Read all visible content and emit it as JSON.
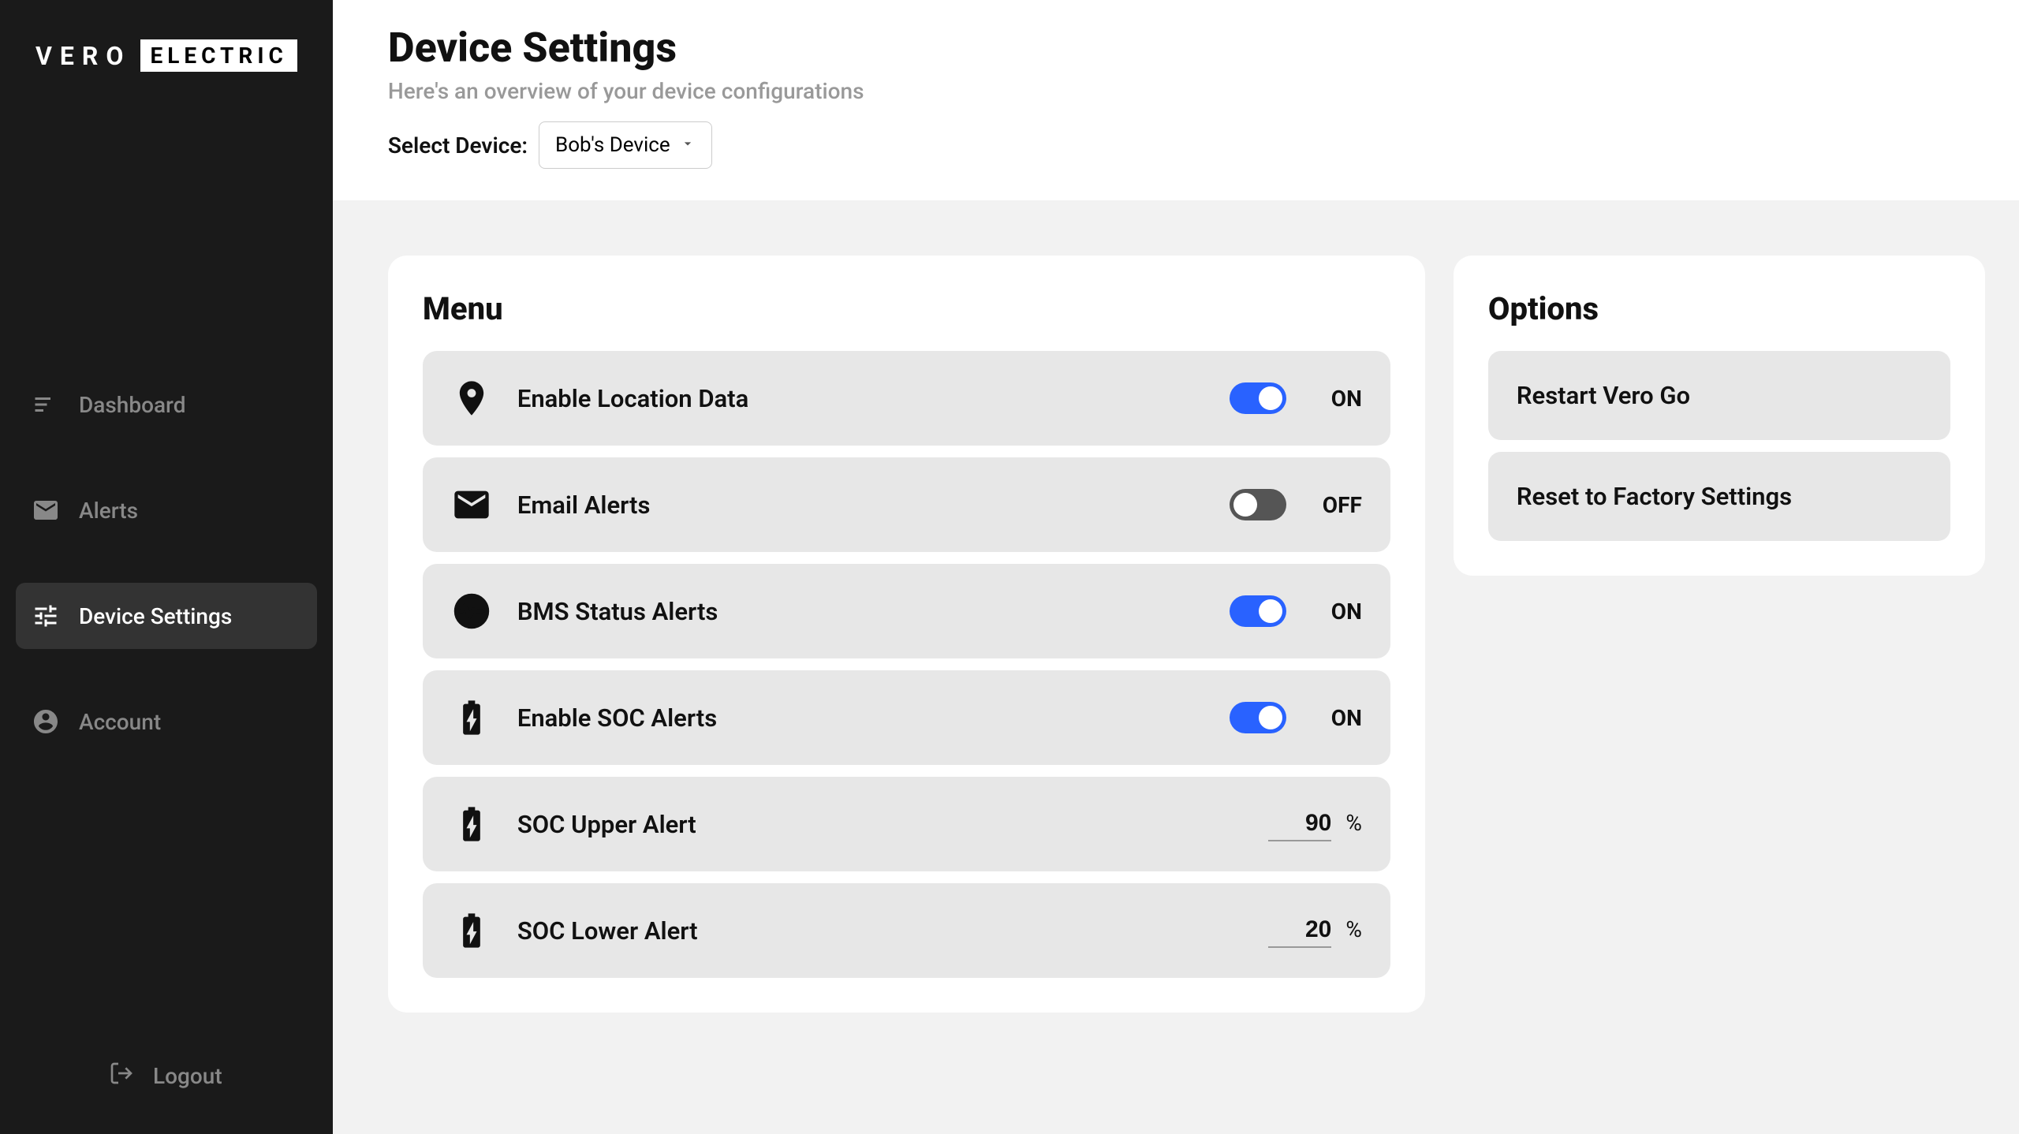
{
  "brand": {
    "part1": "VERO",
    "part2": "ELECTRIC"
  },
  "sidebar": {
    "items": [
      {
        "label": "Dashboard"
      },
      {
        "label": "Alerts"
      },
      {
        "label": "Device Settings"
      },
      {
        "label": "Account"
      }
    ],
    "logout": "Logout"
  },
  "header": {
    "title": "Device Settings",
    "subtitle": "Here's an overview of your device configurations",
    "select_label": "Select Device:",
    "selected_device": "Bob's Device"
  },
  "menu": {
    "title": "Menu",
    "items": [
      {
        "label": "Enable Location Data",
        "state": "ON"
      },
      {
        "label": "Email Alerts",
        "state": "OFF"
      },
      {
        "label": "BMS Status Alerts",
        "state": "ON"
      },
      {
        "label": "Enable SOC Alerts",
        "state": "ON"
      },
      {
        "label": "SOC Upper Alert",
        "value": "90",
        "unit": "%"
      },
      {
        "label": "SOC Lower Alert",
        "value": "20",
        "unit": "%"
      }
    ]
  },
  "options": {
    "title": "Options",
    "buttons": [
      {
        "label": "Restart Vero Go"
      },
      {
        "label": "Reset to Factory Settings"
      }
    ]
  }
}
